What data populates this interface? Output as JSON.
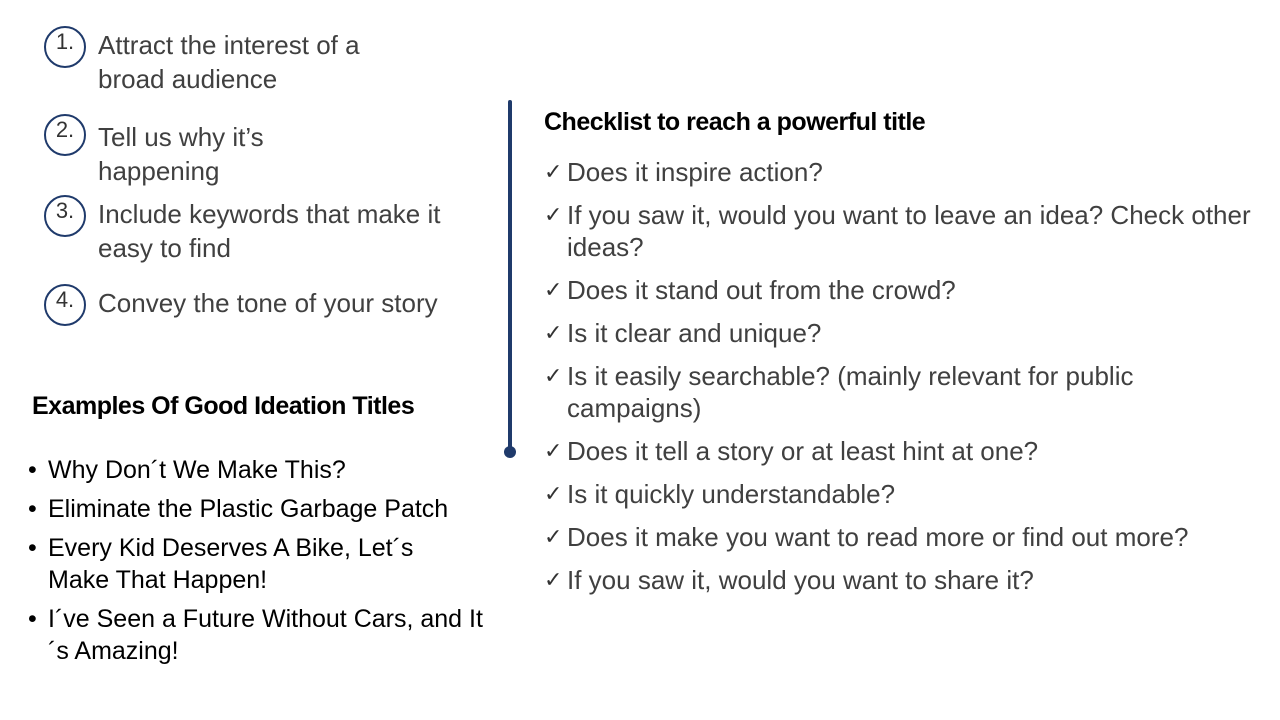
{
  "steps": [
    {
      "number": "1.",
      "text": "Attract the interest of a broad audience"
    },
    {
      "number": "2.",
      "text": "Tell us why it’s happening"
    },
    {
      "number": "3.",
      "text": "Include keywords that make it easy to find"
    },
    {
      "number": "4.",
      "text": "Convey the tone of your story"
    }
  ],
  "examples": {
    "title": "Examples Of Good Ideation Titles",
    "bullet_glyph": "•",
    "items": [
      "Why Don´t We Make This?",
      "Eliminate the Plastic Garbage Patch",
      "Every Kid Deserves A Bike, Let´s Make That Happen!",
      "I´ve Seen a Future Without Cars, and It´s Amazing!"
    ]
  },
  "checklist": {
    "title": "Checklist to reach a powerful title",
    "check_glyph": "✓",
    "items": [
      "Does it inspire action?",
      "If you saw it, would you want to leave an idea? Check other ideas?",
      "Does it stand out from the crowd?",
      "Is it clear and unique?",
      "Is it easily searchable? (mainly relevant for public campaigns)",
      "Does it tell a story or at least hint at one?",
      "Is it quickly understandable?",
      "Does it make you want to read more or find out more?",
      "If you saw it, would you want to share it?"
    ]
  },
  "colors": {
    "accent": "#1f3a6b",
    "body_text": "#404040",
    "heading_text": "#000000"
  }
}
